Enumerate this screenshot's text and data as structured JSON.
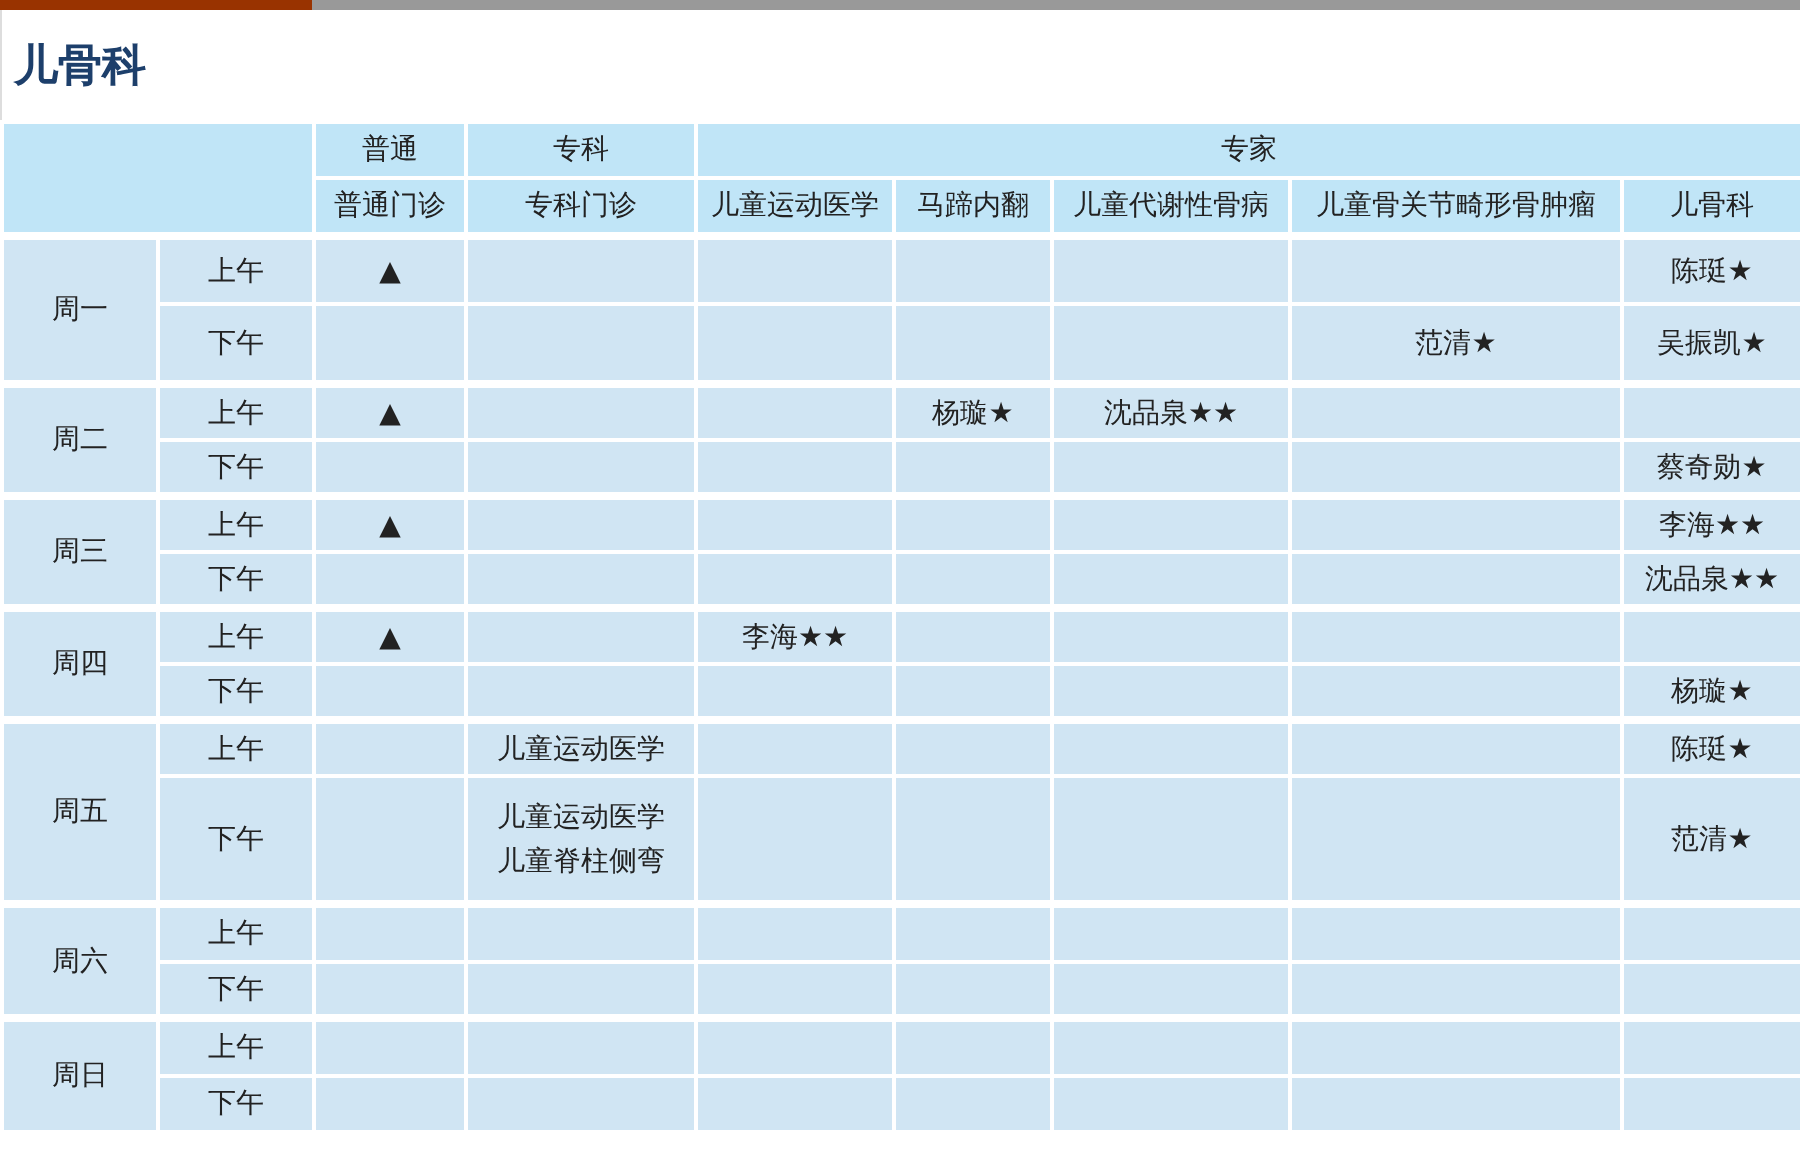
{
  "title": "儿骨科",
  "header": {
    "groups": [
      {
        "label": "普通"
      },
      {
        "label": "专科"
      },
      {
        "label": "专家"
      }
    ],
    "columns": [
      "普通门诊",
      "专科门诊",
      "儿童运动医学",
      "马蹄内翻",
      "儿童代谢性骨病",
      "儿童骨关节畸形骨肿瘤",
      "儿骨科"
    ]
  },
  "days": [
    {
      "label": "周一",
      "slots": [
        {
          "label": "上午",
          "cells": [
            [
              "▲"
            ],
            null,
            null,
            null,
            null,
            null,
            [
              "陈珽★"
            ]
          ]
        },
        {
          "label": "下午",
          "cells": [
            null,
            null,
            null,
            null,
            null,
            [
              "范清★"
            ],
            [
              "吴振凯★"
            ]
          ]
        }
      ]
    },
    {
      "label": "周二",
      "slots": [
        {
          "label": "上午",
          "cells": [
            [
              "▲"
            ],
            null,
            null,
            [
              "杨璇★"
            ],
            [
              "沈品泉★★"
            ],
            null,
            null
          ]
        },
        {
          "label": "下午",
          "cells": [
            null,
            null,
            null,
            null,
            null,
            null,
            [
              "蔡奇勋★"
            ]
          ]
        }
      ]
    },
    {
      "label": "周三",
      "slots": [
        {
          "label": "上午",
          "cells": [
            [
              "▲"
            ],
            null,
            null,
            null,
            null,
            null,
            [
              "李海★★"
            ]
          ]
        },
        {
          "label": "下午",
          "cells": [
            null,
            null,
            null,
            null,
            null,
            null,
            [
              "沈品泉★★"
            ]
          ]
        }
      ]
    },
    {
      "label": "周四",
      "slots": [
        {
          "label": "上午",
          "cells": [
            [
              "▲"
            ],
            null,
            [
              "李海★★"
            ],
            null,
            null,
            null,
            null
          ]
        },
        {
          "label": "下午",
          "cells": [
            null,
            null,
            null,
            null,
            null,
            null,
            [
              "杨璇★"
            ]
          ]
        }
      ]
    },
    {
      "label": "周五",
      "slots": [
        {
          "label": "上午",
          "cells": [
            null,
            [
              "儿童运动医学"
            ],
            null,
            null,
            null,
            null,
            [
              "陈珽★"
            ]
          ]
        },
        {
          "label": "下午",
          "cells": [
            null,
            [
              "儿童运动医学",
              "儿童脊柱侧弯"
            ],
            null,
            null,
            null,
            null,
            [
              "范清★"
            ]
          ]
        }
      ]
    },
    {
      "label": "周六",
      "slots": [
        {
          "label": "上午",
          "cells": [
            null,
            null,
            null,
            null,
            null,
            null,
            null
          ]
        },
        {
          "label": "下午",
          "cells": [
            null,
            null,
            null,
            null,
            null,
            null,
            null
          ]
        }
      ]
    },
    {
      "label": "周日",
      "slots": [
        {
          "label": "上午",
          "cells": [
            null,
            null,
            null,
            null,
            null,
            null,
            null
          ]
        },
        {
          "label": "下午",
          "cells": [
            null,
            null,
            null,
            null,
            null,
            null,
            null
          ]
        }
      ]
    }
  ]
}
